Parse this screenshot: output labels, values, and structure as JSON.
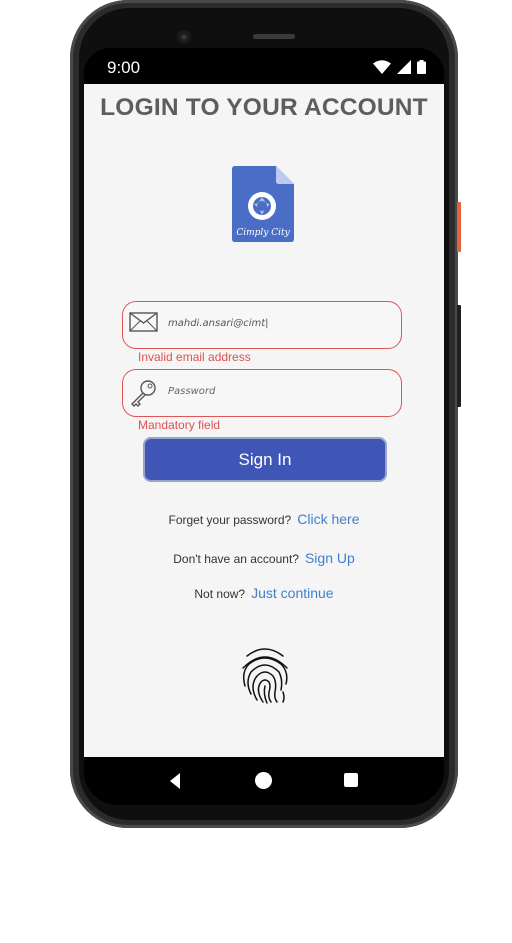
{
  "status_bar": {
    "time": "9:00",
    "icons": [
      "wifi-icon",
      "signal-icon",
      "battery-icon"
    ]
  },
  "page": {
    "title": "LOGIN TO YOUR ACCOUNT"
  },
  "logo": {
    "text": "Cimply City",
    "color": "#4a6ec6"
  },
  "email": {
    "value": "mahdi.ansari@cimt|",
    "error": "Invalid email address",
    "icon": "envelope-icon"
  },
  "password": {
    "placeholder": "Password",
    "error": "Mandatory field",
    "icon": "key-icon"
  },
  "signin": {
    "label": "Sign In",
    "color": "#4056b7"
  },
  "forgot": {
    "prompt": "Forget your password?",
    "link": "Click here"
  },
  "signup": {
    "prompt": "Don't have an account?",
    "link": "Sign Up"
  },
  "skip": {
    "prompt": "Not now?",
    "link": "Just continue"
  },
  "biometric": {
    "icon": "fingerprint-icon"
  },
  "nav_bar": {
    "icons": [
      "back-icon",
      "home-icon",
      "recents-icon"
    ]
  },
  "colors": {
    "error": "#e05050",
    "link": "#3f7fd0",
    "title": "#5d5d5d"
  }
}
